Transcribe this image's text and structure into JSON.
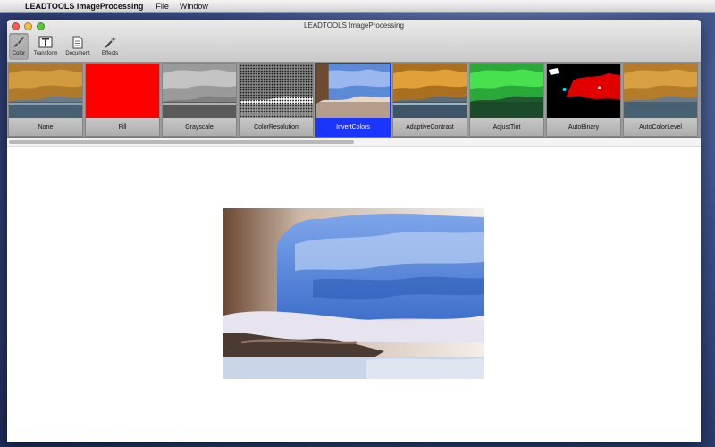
{
  "menubar": {
    "app_name": "LEADTOOLS ImageProcessing",
    "items": [
      "File",
      "Window"
    ]
  },
  "window": {
    "title": "LEADTOOLS ImageProcessing"
  },
  "toolbar": {
    "tools": [
      {
        "label": "Color",
        "icon": "brush-icon",
        "active": true
      },
      {
        "label": "Transform",
        "icon": "text-frame-icon",
        "active": false
      },
      {
        "label": "Document",
        "icon": "document-icon",
        "active": false
      },
      {
        "label": "Effects",
        "icon": "magic-wand-icon",
        "active": false
      }
    ]
  },
  "filters": [
    {
      "label": "None",
      "style": "original"
    },
    {
      "label": "Fill",
      "style": "fill-red"
    },
    {
      "label": "Grayscale",
      "style": "grayscale"
    },
    {
      "label": "ColorResolution",
      "style": "dither"
    },
    {
      "label": "InvertColors",
      "style": "inverted",
      "selected": true
    },
    {
      "label": "AdaptiveContrast",
      "style": "contrast"
    },
    {
      "label": "AdjustTint",
      "style": "green-tint"
    },
    {
      "label": "AutoBinary",
      "style": "binary"
    },
    {
      "label": "AutoColorLevel",
      "style": "original"
    }
  ],
  "colors": {
    "selected_accent": "#1b34ff",
    "fill_red": "#ff0000"
  }
}
